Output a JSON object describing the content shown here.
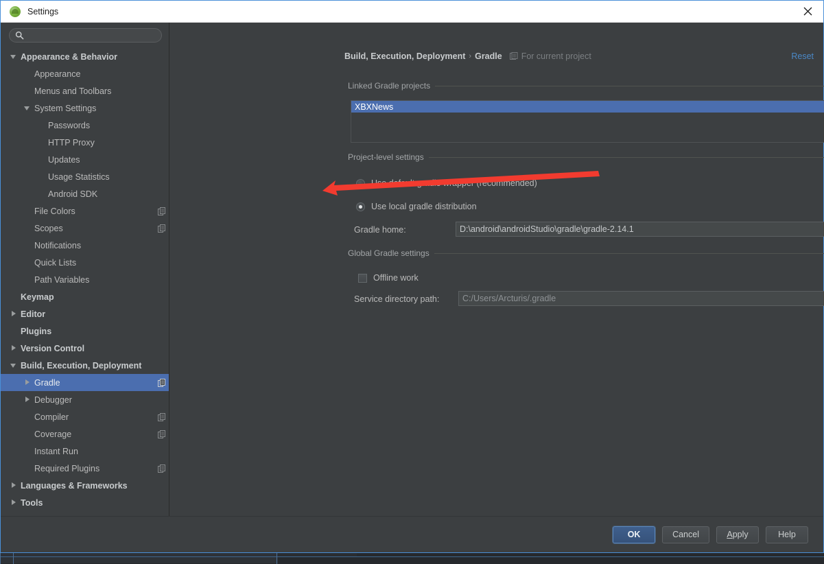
{
  "window": {
    "title": "Settings",
    "app_icon": "android-studio-icon",
    "close_icon": "close-icon"
  },
  "sidebar": {
    "search": {
      "value": "",
      "placeholder": "",
      "icon": "search-icon"
    },
    "items": [
      {
        "label": "Appearance & Behavior",
        "indent": 0,
        "twisty": "expanded",
        "bold": true,
        "badge": false,
        "selected": false
      },
      {
        "label": "Appearance",
        "indent": 1,
        "twisty": "none",
        "bold": false,
        "badge": false,
        "selected": false
      },
      {
        "label": "Menus and Toolbars",
        "indent": 1,
        "twisty": "none",
        "bold": false,
        "badge": false,
        "selected": false
      },
      {
        "label": "System Settings",
        "indent": 1,
        "twisty": "expanded",
        "bold": false,
        "badge": false,
        "selected": false
      },
      {
        "label": "Passwords",
        "indent": 2,
        "twisty": "none",
        "bold": false,
        "badge": false,
        "selected": false
      },
      {
        "label": "HTTP Proxy",
        "indent": 2,
        "twisty": "none",
        "bold": false,
        "badge": false,
        "selected": false
      },
      {
        "label": "Updates",
        "indent": 2,
        "twisty": "none",
        "bold": false,
        "badge": false,
        "selected": false
      },
      {
        "label": "Usage Statistics",
        "indent": 2,
        "twisty": "none",
        "bold": false,
        "badge": false,
        "selected": false
      },
      {
        "label": "Android SDK",
        "indent": 2,
        "twisty": "none",
        "bold": false,
        "badge": false,
        "selected": false
      },
      {
        "label": "File Colors",
        "indent": 1,
        "twisty": "none",
        "bold": false,
        "badge": true,
        "selected": false
      },
      {
        "label": "Scopes",
        "indent": 1,
        "twisty": "none",
        "bold": false,
        "badge": true,
        "selected": false
      },
      {
        "label": "Notifications",
        "indent": 1,
        "twisty": "none",
        "bold": false,
        "badge": false,
        "selected": false
      },
      {
        "label": "Quick Lists",
        "indent": 1,
        "twisty": "none",
        "bold": false,
        "badge": false,
        "selected": false
      },
      {
        "label": "Path Variables",
        "indent": 1,
        "twisty": "none",
        "bold": false,
        "badge": false,
        "selected": false
      },
      {
        "label": "Keymap",
        "indent": 0,
        "twisty": "none",
        "bold": true,
        "badge": false,
        "selected": false
      },
      {
        "label": "Editor",
        "indent": 0,
        "twisty": "collapsed",
        "bold": true,
        "badge": false,
        "selected": false
      },
      {
        "label": "Plugins",
        "indent": 0,
        "twisty": "none",
        "bold": true,
        "badge": false,
        "selected": false
      },
      {
        "label": "Version Control",
        "indent": 0,
        "twisty": "collapsed",
        "bold": true,
        "badge": false,
        "selected": false
      },
      {
        "label": "Build, Execution, Deployment",
        "indent": 0,
        "twisty": "expanded",
        "bold": true,
        "badge": false,
        "selected": false
      },
      {
        "label": "Gradle",
        "indent": 1,
        "twisty": "collapsed",
        "bold": false,
        "badge": true,
        "selected": true
      },
      {
        "label": "Debugger",
        "indent": 1,
        "twisty": "collapsed",
        "bold": false,
        "badge": false,
        "selected": false
      },
      {
        "label": "Compiler",
        "indent": 1,
        "twisty": "none",
        "bold": false,
        "badge": true,
        "selected": false
      },
      {
        "label": "Coverage",
        "indent": 1,
        "twisty": "none",
        "bold": false,
        "badge": true,
        "selected": false
      },
      {
        "label": "Instant Run",
        "indent": 1,
        "twisty": "none",
        "bold": false,
        "badge": false,
        "selected": false
      },
      {
        "label": "Required Plugins",
        "indent": 1,
        "twisty": "none",
        "bold": false,
        "badge": true,
        "selected": false
      },
      {
        "label": "Languages & Frameworks",
        "indent": 0,
        "twisty": "collapsed",
        "bold": true,
        "badge": false,
        "selected": false
      },
      {
        "label": "Tools",
        "indent": 0,
        "twisty": "collapsed",
        "bold": true,
        "badge": false,
        "selected": false
      }
    ]
  },
  "header": {
    "crumb_1": "Build, Execution, Deployment",
    "separator": "›",
    "crumb_2": "Gradle",
    "scope_icon": "project-scope-icon",
    "scope_text": "For current project",
    "reset_label": "Reset"
  },
  "main": {
    "linked_projects": {
      "title": "Linked Gradle projects",
      "rows": [
        {
          "label": "XBXNews",
          "selected": true
        }
      ]
    },
    "project_level": {
      "title": "Project-level settings",
      "radio_wrapper": {
        "label": "Use default gradle wrapper (recommended)",
        "checked": false
      },
      "radio_local": {
        "label": "Use local gradle distribution",
        "checked": true
      },
      "gradle_home": {
        "label": "Gradle home:",
        "value": "D:\\android\\androidStudio\\gradle\\gradle-2.14.1",
        "browse_label": "..."
      }
    },
    "global_settings": {
      "title": "Global Gradle settings",
      "offline_work": {
        "label": "Offline work",
        "checked": false
      },
      "service_dir": {
        "label": "Service directory path:",
        "value": "C:/Users/Arcturis/.gradle",
        "browse_label": "..."
      }
    }
  },
  "footer": {
    "ok": "OK",
    "cancel": "Cancel",
    "apply_mnemonic": "A",
    "apply_rest": "pply",
    "help": "Help"
  },
  "annotation": {
    "type": "arrow",
    "color": "#f23b2f",
    "points_at": "Use local gradle distribution"
  },
  "colors": {
    "window_bg": "#3c3f41",
    "selection_blue": "#4b6eaf",
    "link_blue": "#4a88c7",
    "titlebar_bg": "#ffffff",
    "border_accent": "#4a90d9"
  }
}
